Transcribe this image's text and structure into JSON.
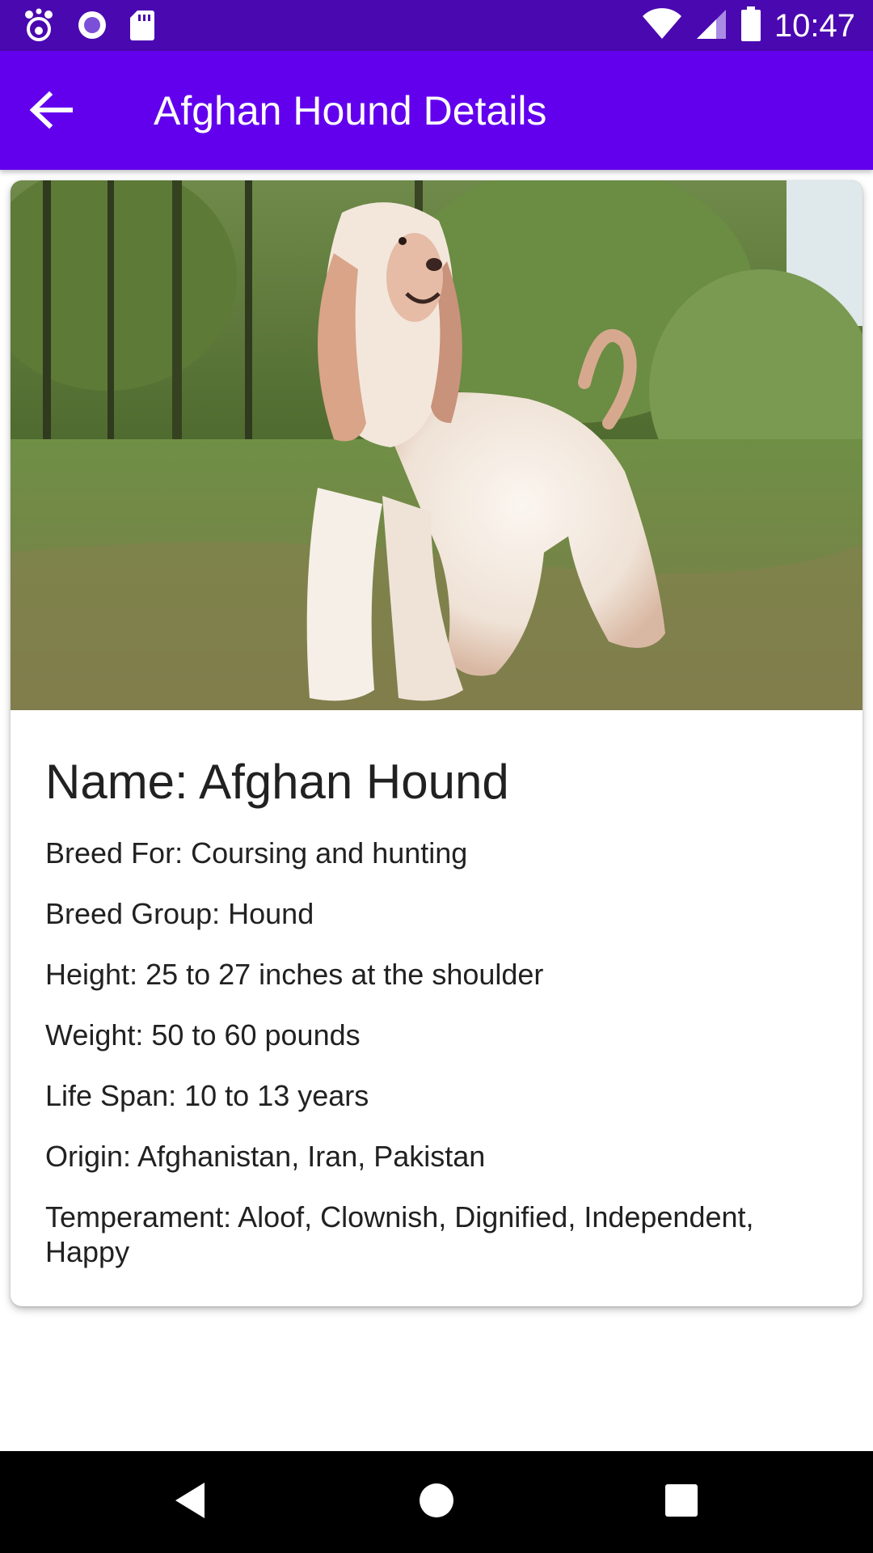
{
  "status_bar": {
    "time": "10:47",
    "icons_left": [
      "paw-icon",
      "record-icon",
      "sd-card-icon"
    ],
    "icons_right": [
      "wifi-icon",
      "signal-icon",
      "battery-icon"
    ]
  },
  "app_bar": {
    "title": "Afghan Hound Details",
    "back_icon": "arrow-left-icon"
  },
  "card": {
    "image_subject": "dog",
    "name": "Name: Afghan Hound",
    "details": [
      "Breed For: Coursing and hunting",
      "Breed Group: Hound",
      "Height: 25 to 27 inches at the shoulder",
      "Weight: 50 to 60 pounds",
      "Life Span: 10 to 13 years",
      "Origin: Afghanistan, Iran, Pakistan",
      "Temperament: Aloof, Clownish, Dignified, Independent, Happy"
    ]
  },
  "nav_bar": {
    "buttons": [
      "back-triangle-icon",
      "home-circle-icon",
      "recents-square-icon"
    ]
  },
  "colors": {
    "status_bar": "#4a08b0",
    "app_bar": "#6200ee",
    "nav_bar": "#000000",
    "card_background": "#ffffff"
  }
}
